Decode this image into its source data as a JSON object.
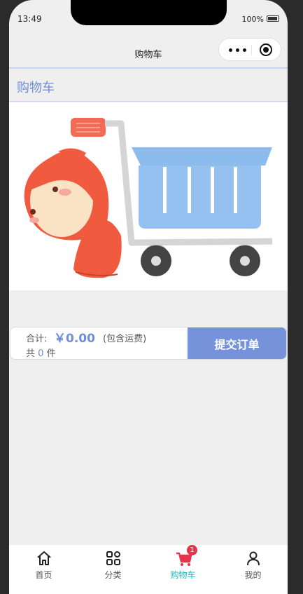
{
  "status_bar": {
    "time": "13:49",
    "battery": "100%"
  },
  "nav": {
    "title": "购物车"
  },
  "page": {
    "title": "购物车"
  },
  "summary": {
    "total_label": "合计:",
    "total_value": "￥0.00",
    "total_note": "(包含运费)",
    "count_prefix": "共",
    "count_value": "0",
    "count_suffix": "件",
    "submit_label": "提交订单"
  },
  "tabbar": {
    "items": [
      {
        "label": "首页",
        "icon": "home-icon"
      },
      {
        "label": "分类",
        "icon": "grid-icon"
      },
      {
        "label": "购物车",
        "icon": "cart-icon",
        "badge": "1",
        "active": true
      },
      {
        "label": "我的",
        "icon": "user-icon"
      }
    ]
  },
  "colors": {
    "accent": "#7592db",
    "title": "#6f8fd6",
    "active_tab": "#24b3b3",
    "badge": "#e8334a"
  }
}
